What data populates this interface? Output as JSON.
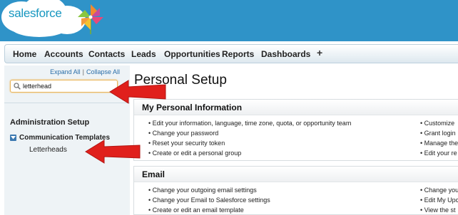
{
  "logo": {
    "text": "salesforce",
    "version": "13"
  },
  "tabs": [
    {
      "label": "Home"
    },
    {
      "label": "Accounts"
    },
    {
      "label": "Contacts"
    },
    {
      "label": "Leads"
    },
    {
      "label": "Opportunities"
    },
    {
      "label": "Reports"
    },
    {
      "label": "Dashboards"
    }
  ],
  "tab_plus": "+",
  "sidebar": {
    "expand_all": "Expand All",
    "separator": "|",
    "collapse_all": "Collapse All",
    "search_value": "letterhead",
    "admin_title": "Administration Setup",
    "category": "Communication Templates",
    "link": "Letterheads"
  },
  "page_title": "Personal Setup",
  "sections": [
    {
      "title": "My Personal Information",
      "left_items": [
        "• Edit your information, language, time zone, quota, or opportunity team",
        "• Change your password",
        "• Reset your security token",
        "• Create or edit a personal group"
      ],
      "right_items": [
        "• Customize",
        "• Grant login",
        "• Manage the",
        "• Edit your re"
      ]
    },
    {
      "title": "Email",
      "left_items": [
        "• Change your outgoing email settings",
        "• Change your Email to Salesforce settings",
        "• Create or edit an email template"
      ],
      "right_items": [
        "• Change you",
        "• Edit My Upc",
        "• View the st"
      ]
    }
  ],
  "colors": {
    "header": "#2f93c8",
    "arrow": "#e0201c",
    "search_border": "#e9b55a"
  }
}
